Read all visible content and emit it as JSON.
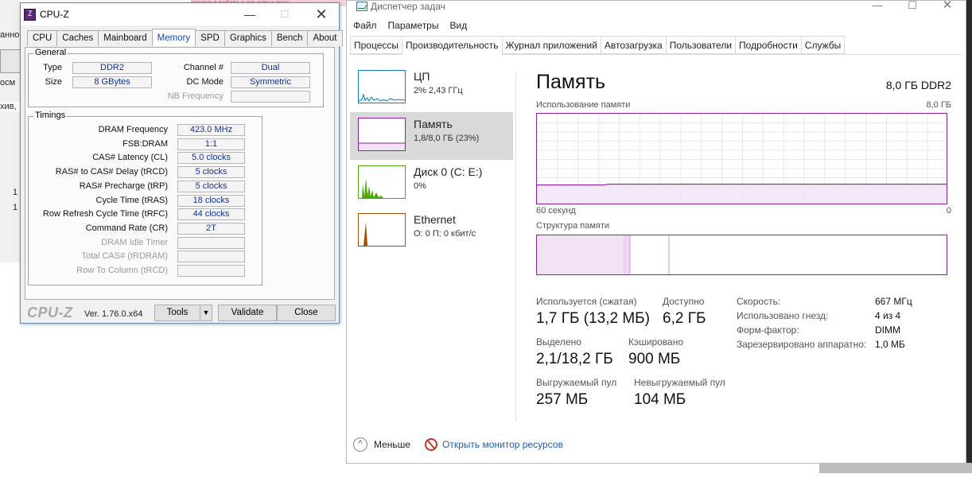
{
  "background": {
    "left_strip_texts": [
      "анно",
      "осм",
      "хив,",
      "1",
      "1"
    ],
    "top_strip_text": "средне в работе в смысле и техн"
  },
  "cpuz": {
    "title": "CPU-Z",
    "icon_text": "Z",
    "tabs": [
      "CPU",
      "Caches",
      "Mainboard",
      "Memory",
      "SPD",
      "Graphics",
      "Bench",
      "About"
    ],
    "active_tab": "Memory",
    "general": {
      "label": "General",
      "type_label": "Type",
      "type_value": "DDR2",
      "size_label": "Size",
      "size_value": "8 GBytes",
      "channel_label": "Channel #",
      "channel_value": "Dual",
      "dcmode_label": "DC Mode",
      "dcmode_value": "Symmetric",
      "nbfreq_label": "NB Frequency",
      "nbfreq_value": ""
    },
    "timings": {
      "label": "Timings",
      "rows": [
        {
          "label": "DRAM Frequency",
          "value": "423.0 MHz",
          "dim": false
        },
        {
          "label": "FSB:DRAM",
          "value": "1:1",
          "dim": false
        },
        {
          "label": "CAS# Latency (CL)",
          "value": "5.0 clocks",
          "dim": false
        },
        {
          "label": "RAS# to CAS# Delay (tRCD)",
          "value": "5 clocks",
          "dim": false
        },
        {
          "label": "RAS# Precharge (tRP)",
          "value": "5 clocks",
          "dim": false
        },
        {
          "label": "Cycle Time (tRAS)",
          "value": "18 clocks",
          "dim": false
        },
        {
          "label": "Row Refresh Cycle Time (tRFC)",
          "value": "44 clocks",
          "dim": false
        },
        {
          "label": "Command Rate (CR)",
          "value": "2T",
          "dim": false
        },
        {
          "label": "DRAM Idle Timer",
          "value": "",
          "dim": true
        },
        {
          "label": "Total CAS# (tRDRAM)",
          "value": "",
          "dim": true
        },
        {
          "label": "Row To Column (tRCD)",
          "value": "",
          "dim": true
        }
      ]
    },
    "footer": {
      "logo": "CPU-Z",
      "version": "Ver. 1.76.0.x64",
      "tools_label": "Tools",
      "tools_arrow": "▼",
      "validate_label": "Validate",
      "close_label": "Close"
    }
  },
  "taskmgr": {
    "title": "Диспетчер задач",
    "menu": [
      "Файл",
      "Параметры",
      "Вид"
    ],
    "tabs": [
      "Процессы",
      "Производительность",
      "Журнал приложений",
      "Автозагрузка",
      "Пользователи",
      "Подробности",
      "Службы"
    ],
    "active_tab": "Производительность",
    "sidebar": [
      {
        "name": "ЦП",
        "sub": "2% 2,43 ГГц",
        "color": "#117dbb",
        "active": false
      },
      {
        "name": "Память",
        "sub": "1,8/8,0 ГБ (23%)",
        "color": "#8b1fa6",
        "active": true
      },
      {
        "name": "Диск 0 (C: E:)",
        "sub": "0%",
        "color": "#4da60c",
        "active": false
      },
      {
        "name": "Ethernet",
        "sub": "О: 0 П: 0 кбит/с",
        "color": "#a74f01",
        "active": false
      }
    ],
    "memory": {
      "heading": "Память",
      "spec": "8,0 ГБ DDR2",
      "usage_label": "Использование памяти",
      "usage_max": "8,0 ГБ",
      "time_left": "60 секунд",
      "time_right": "0",
      "usage_fraction": 0.23,
      "structure_label": "Структура памяти",
      "stats": {
        "in_use_label": "Используется (сжатая)",
        "in_use_value": "1,7 ГБ (13,2 МБ)",
        "available_label": "Доступно",
        "available_value": "6,2 ГБ",
        "committed_label": "Выделено",
        "committed_value": "2,1/18,2 ГБ",
        "cached_label": "Кэшировано",
        "cached_value": "900 МБ",
        "paged_label": "Выгружаемый пул",
        "paged_value": "257 МБ",
        "nonpaged_label": "Невыгружаемый пул",
        "nonpaged_value": "104 МБ"
      },
      "details": [
        {
          "label": "Скорость:",
          "value": "667 МГц"
        },
        {
          "label": "Использовано гнезд:",
          "value": "4 из 4"
        },
        {
          "label": "Форм-фактор:",
          "value": "DIMM"
        },
        {
          "label": "Зарезервировано аппаратно:",
          "value": "1,0 МБ"
        }
      ]
    },
    "footer": {
      "less_label": "Меньше",
      "monitor_label": "Открыть монитор ресурсов"
    }
  }
}
